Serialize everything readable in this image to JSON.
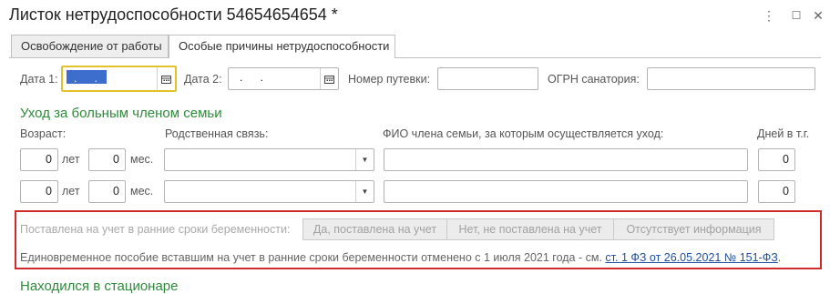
{
  "window": {
    "title": "Листок нетрудоспособности 54654654654 *",
    "more_icon": "⋮",
    "maximize_icon": "☐",
    "close_icon": "✕"
  },
  "tabs": [
    {
      "label": "Освобождение от работы",
      "active": false
    },
    {
      "label": "Особые причины нетрудоспособности",
      "active": true
    }
  ],
  "fields": {
    "date1_label": "Дата 1:",
    "date1_value": " .  .",
    "date2_label": "Дата 2:",
    "date2_value": " .  .",
    "voucher_label": "Номер путевки:",
    "voucher_value": "",
    "ogrn_label": "ОГРН санатория:",
    "ogrn_value": ""
  },
  "care": {
    "section_title": "Уход за больным членом семьи",
    "age_header": "Возраст:",
    "relation_header": "Родственная связь:",
    "fio_header": "ФИО члена семьи, за которым осуществляется уход:",
    "days_header": "Дней в т.г.",
    "years_unit": "лет",
    "months_unit": "мес.",
    "rows": [
      {
        "years": "0",
        "months": "0",
        "relation": "",
        "fio": "",
        "days": "0"
      },
      {
        "years": "0",
        "months": "0",
        "relation": "",
        "fio": "",
        "days": "0"
      }
    ]
  },
  "pregnancy": {
    "label": "Поставлена на учет в ранние сроки беременности:",
    "options": [
      "Да, поставлена на учет",
      "Нет, не поставлена на учет",
      "Отсутствует информация"
    ],
    "note_text": "Единовременное пособие вставшим на учет в ранние сроки беременности отменено с 1 июля 2021 года - см.",
    "note_link": "ст. 1 ФЗ от 26.05.2021 № 151-ФЗ",
    "note_end": "."
  },
  "next_section_title": "Находился в стационаре",
  "colors": {
    "highlight": "#d12a2a",
    "section": "#2e8b3a",
    "focus": "#e3c12b",
    "link": "#1f4fa0"
  }
}
